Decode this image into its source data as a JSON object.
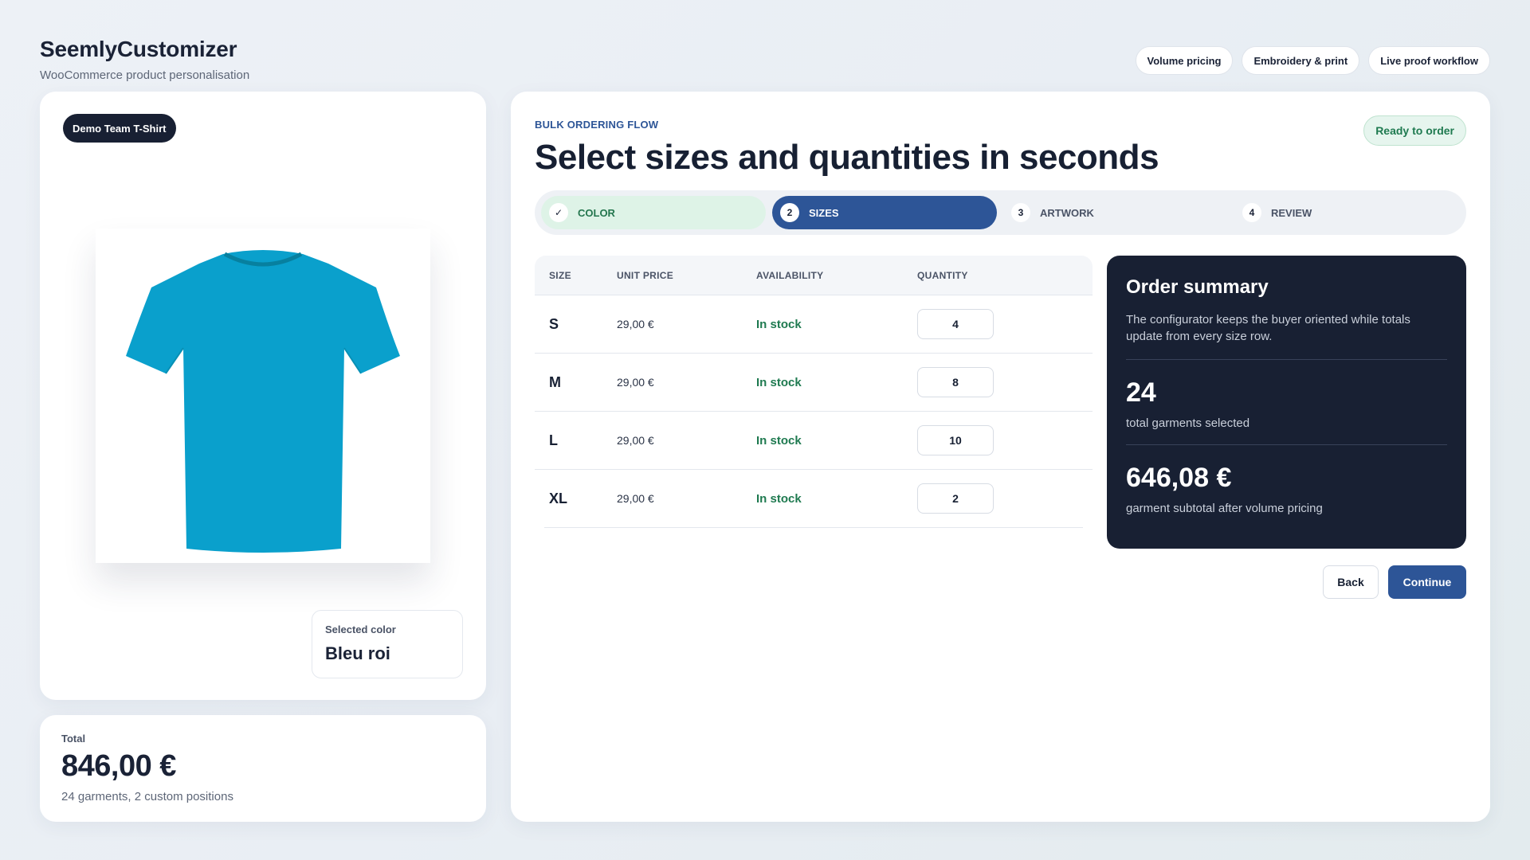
{
  "brand": {
    "title": "SeemlyCustomizer",
    "subtitle": "WooCommerce product personalisation"
  },
  "chips": [
    "Volume pricing",
    "Embroidery & print",
    "Live proof workflow"
  ],
  "product": {
    "badge": "Demo Team T-Shirt",
    "shirt_color": "#0aa0cc",
    "selected_color_label": "Selected color",
    "selected_color_value": "Bleu roi"
  },
  "total": {
    "label": "Total",
    "value": "846,00 €",
    "sub": "24 garments, 2 custom positions"
  },
  "main": {
    "eyebrow": "BULK ORDERING FLOW",
    "title": "Select sizes and quantities in seconds",
    "status_badge": "Ready to order"
  },
  "steps": [
    {
      "num": "✓",
      "label": "COLOR",
      "state": "done"
    },
    {
      "num": "2",
      "label": "SIZES",
      "state": "active"
    },
    {
      "num": "3",
      "label": "ARTWORK",
      "state": "todo"
    },
    {
      "num": "4",
      "label": "REVIEW",
      "state": "todo"
    }
  ],
  "table": {
    "headers": [
      "SIZE",
      "UNIT PRICE",
      "AVAILABILITY",
      "QUANTITY"
    ],
    "rows": [
      {
        "size": "S",
        "price": "29,00 €",
        "availability": "In stock",
        "qty": "4"
      },
      {
        "size": "M",
        "price": "29,00 €",
        "availability": "In stock",
        "qty": "8"
      },
      {
        "size": "L",
        "price": "29,00 €",
        "availability": "In stock",
        "qty": "10"
      },
      {
        "size": "XL",
        "price": "29,00 €",
        "availability": "In stock",
        "qty": "2"
      }
    ]
  },
  "summary": {
    "title": "Order summary",
    "description": "The configurator keeps the buyer oriented while totals update from every size row.",
    "garments_value": "24",
    "garments_label": "total garments selected",
    "subtotal_value": "646,08 €",
    "subtotal_label": "garment subtotal after volume pricing"
  },
  "buttons": {
    "back": "Back",
    "continue": "Continue"
  }
}
